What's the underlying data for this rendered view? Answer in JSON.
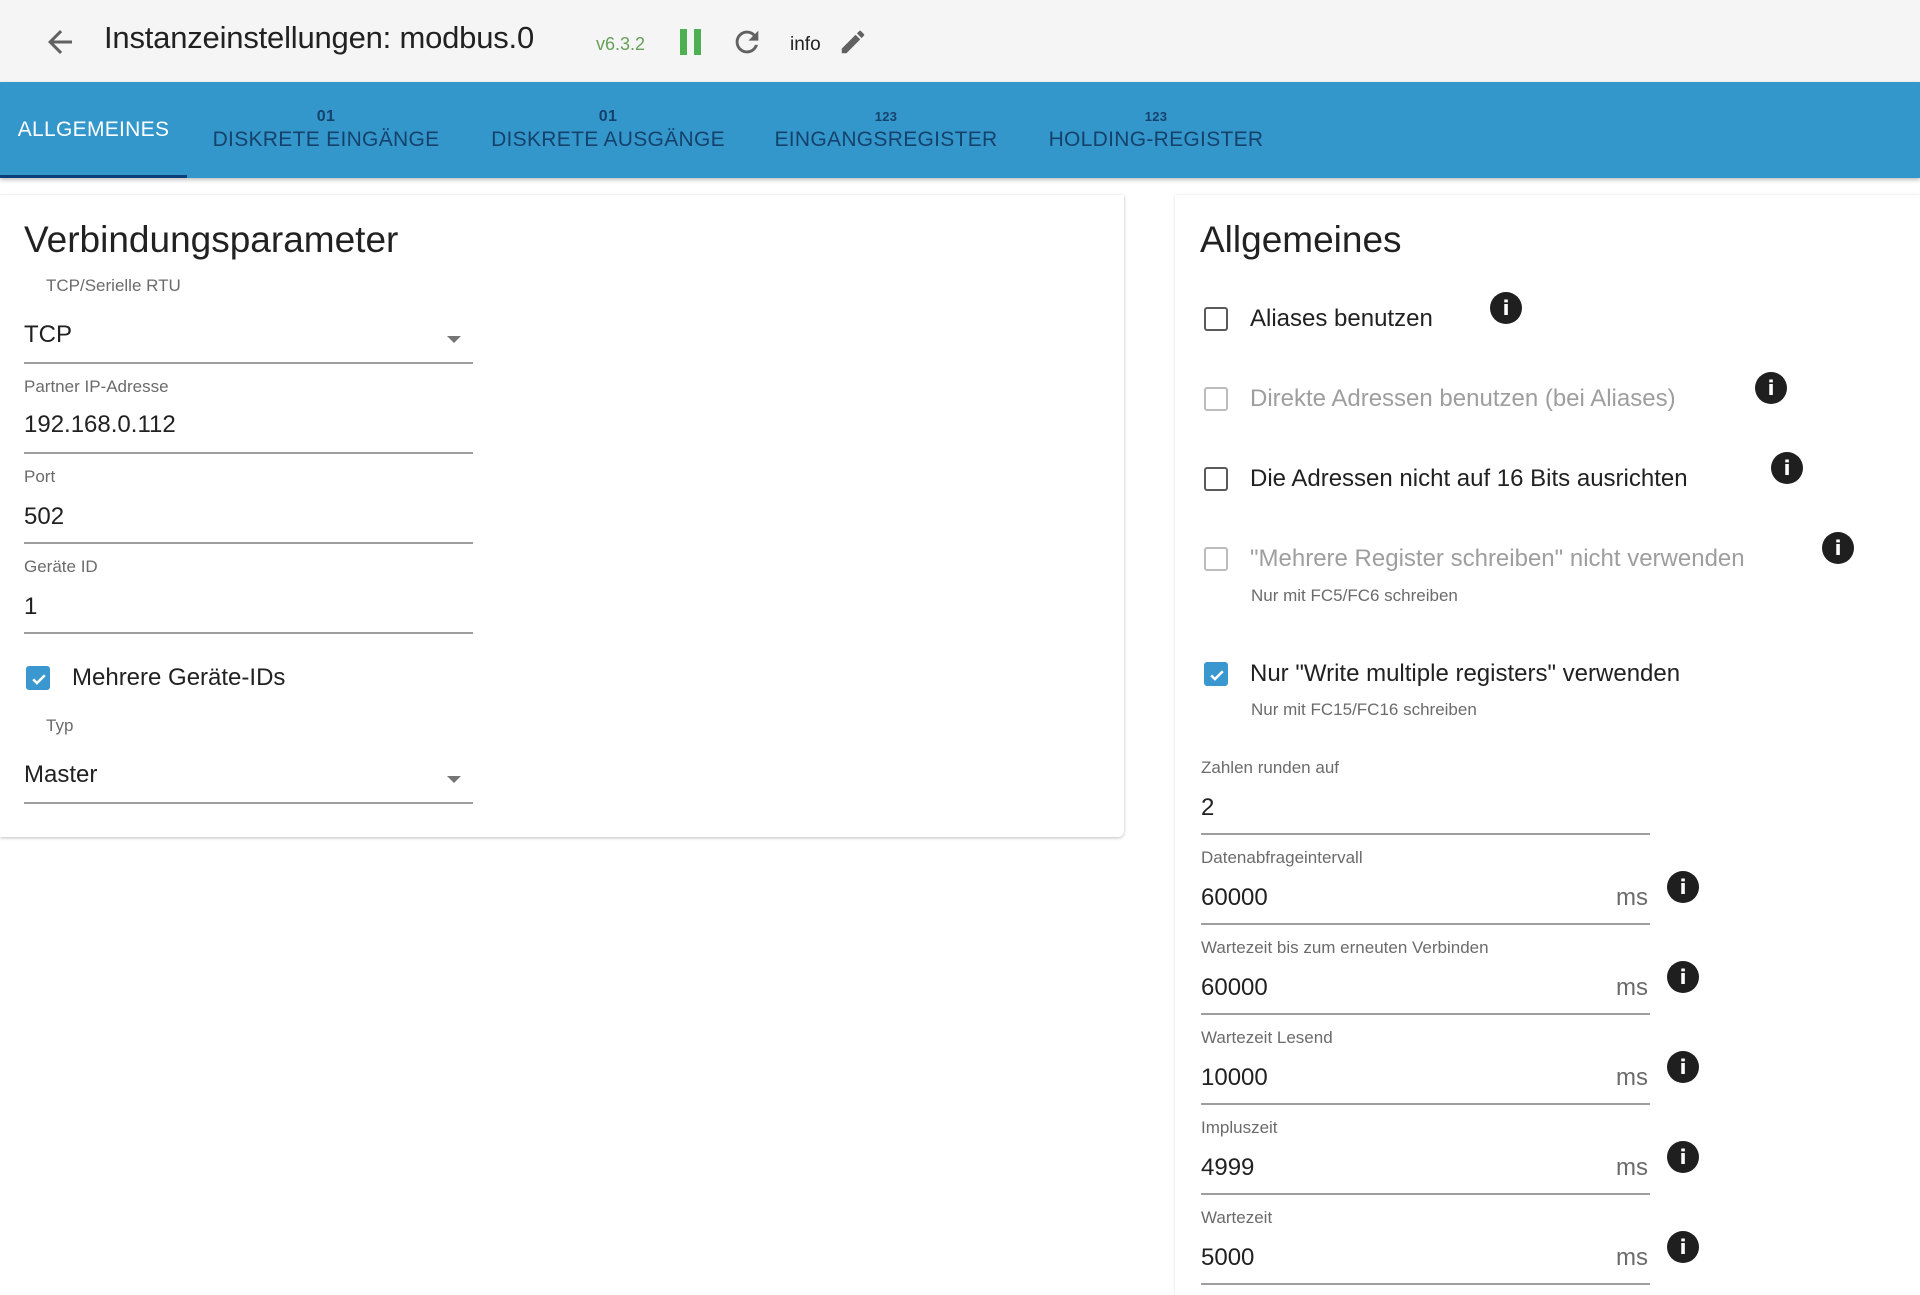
{
  "header": {
    "title": "Instanzeinstellungen: modbus.0",
    "version": "v6.3.2",
    "info_label": "info",
    "icons": [
      "arrow-back-icon",
      "pause-icon",
      "reload-icon",
      "pencil-icon"
    ]
  },
  "tabs": [
    {
      "label": "Allgemeines",
      "icon_text": "",
      "active": true
    },
    {
      "label": "Diskrete Eingänge",
      "icon_text": "01",
      "active": false
    },
    {
      "label": "Diskrete Ausgänge",
      "icon_text": "01",
      "active": false
    },
    {
      "label": "Eingangsregister",
      "icon_text": "123",
      "active": false
    },
    {
      "label": "Holding-Register",
      "icon_text": "123",
      "active": false
    }
  ],
  "connection": {
    "title": "Verbindungsparameter",
    "mode": {
      "label": "TCP/Serielle RTU",
      "value": "TCP"
    },
    "ip": {
      "label": "Partner IP-Adresse",
      "value": "192.168.0.112"
    },
    "port": {
      "label": "Port",
      "value": "502"
    },
    "device_id": {
      "label": "Geräte ID",
      "value": "1"
    },
    "multi_ids": {
      "label": "Mehrere Geräte-IDs",
      "checked": true
    },
    "type": {
      "label": "Typ",
      "value": "Master"
    }
  },
  "general": {
    "title": "Allgemeines",
    "options": [
      {
        "label": "Aliases benutzen",
        "checked": false,
        "disabled": false,
        "sub": ""
      },
      {
        "label": "Direkte Adressen benutzen (bei Aliases)",
        "checked": false,
        "disabled": true,
        "sub": ""
      },
      {
        "label": "Die Adressen nicht auf 16 Bits ausrichten",
        "checked": false,
        "disabled": false,
        "sub": ""
      },
      {
        "label": "\"Mehrere Register schreiben\" nicht verwenden",
        "checked": false,
        "disabled": true,
        "sub": "Nur mit FC5/FC6 schreiben"
      },
      {
        "label": "Nur \"Write multiple registers\" verwenden",
        "checked": true,
        "disabled": false,
        "sub": "Nur mit FC15/FC16 schreiben"
      }
    ],
    "fields": [
      {
        "label": "Zahlen runden auf",
        "value": "2",
        "unit": ""
      },
      {
        "label": "Datenabfrageintervall",
        "value": "60000",
        "unit": "ms"
      },
      {
        "label": "Wartezeit bis zum erneuten Verbinden",
        "value": "60000",
        "unit": "ms"
      },
      {
        "label": "Wartezeit Lesend",
        "value": "10000",
        "unit": "ms"
      },
      {
        "label": "Impluszeit",
        "value": "4999",
        "unit": "ms"
      },
      {
        "label": "Wartezeit",
        "value": "5000",
        "unit": "ms"
      }
    ]
  },
  "colors": {
    "tab_bar": "#3497cc",
    "tab_active_text": "#ffffff",
    "tab_inactive_text": "#15426b",
    "tab_indicator": "#0b3e79",
    "checkbox_checked": "#3a97d0",
    "version_text": "#66a05a",
    "pause_icon": "#4caf50"
  }
}
